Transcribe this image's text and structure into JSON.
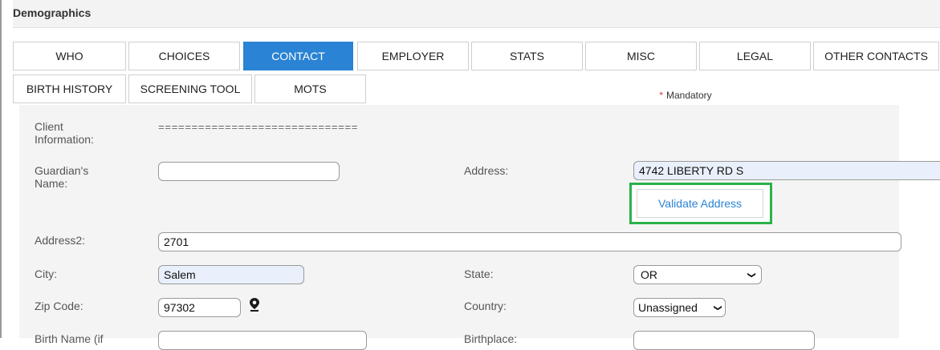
{
  "window": {
    "title": "Demographics"
  },
  "tabs_row1": [
    {
      "label": "WHO",
      "active": false
    },
    {
      "label": "CHOICES",
      "active": false
    },
    {
      "label": "CONTACT",
      "active": true
    },
    {
      "label": "EMPLOYER",
      "active": false
    },
    {
      "label": "STATS",
      "active": false
    },
    {
      "label": "MISC",
      "active": false
    },
    {
      "label": "LEGAL",
      "active": false
    },
    {
      "label": "OTHER CONTACTS",
      "active": false
    }
  ],
  "tabs_row2": [
    {
      "label": "BIRTH HISTORY"
    },
    {
      "label": "SCREENING TOOL"
    },
    {
      "label": "MOTS"
    }
  ],
  "mandatory_note": {
    "star": "*",
    "text": "Mandatory"
  },
  "form": {
    "client_info": {
      "label": "Client\nInformation:",
      "value": "=============================="
    },
    "guardian_name": {
      "label": "Guardian's\nName:",
      "value": ""
    },
    "address": {
      "label": "Address:",
      "value": "4742 LIBERTY RD S"
    },
    "validate_address": {
      "label": "Validate Address"
    },
    "address2": {
      "label": "Address2:",
      "value": "2701"
    },
    "city": {
      "label": "City:",
      "value": "Salem"
    },
    "state": {
      "label": "State:",
      "value": "OR"
    },
    "zip": {
      "label": "Zip Code:",
      "value": "97302"
    },
    "country": {
      "label": "Country:",
      "value": "Unassigned"
    },
    "birth_name": {
      "label": "Birth Name (if"
    },
    "birthplace": {
      "label": "Birthplace:"
    }
  },
  "colors": {
    "accent": "#2a83d4",
    "highlight": "#2ab24a",
    "filled_input": "#e9f0fb"
  },
  "icons": {
    "zip_locate": "map-pin-icon",
    "select": "chevron-down-icon"
  }
}
